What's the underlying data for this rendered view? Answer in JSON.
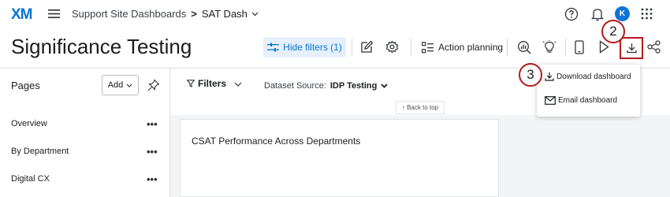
{
  "topbar": {
    "logo": "XM",
    "breadcrumb": {
      "parent": "Support Site Dashboards",
      "separator": ">",
      "current": "SAT Dash"
    },
    "avatar_initial": "K"
  },
  "header": {
    "title": "Significance Testing",
    "hide_filters_label": "Hide filters (1)",
    "action_planning_label": "Action planning"
  },
  "callouts": {
    "download": "2",
    "download_dashboard": "3"
  },
  "dropdown": {
    "items": [
      {
        "label": "Download dashboard",
        "icon": "download-icon"
      },
      {
        "label": "Email dashboard",
        "icon": "envelope-icon"
      }
    ]
  },
  "sidebar": {
    "pages_label": "Pages",
    "add_label": "Add",
    "items": [
      {
        "label": "Overview"
      },
      {
        "label": "By Department"
      },
      {
        "label": "Digital CX"
      }
    ],
    "more": "•••"
  },
  "filters": {
    "label": "Filters",
    "dataset_prefix": "Dataset Source:",
    "dataset_value": "IDP Testing"
  },
  "back_to_top": "↑ Back to top",
  "widget": {
    "title": "CSAT Performance Across Departments"
  },
  "colors": {
    "accent": "#0b73d4",
    "callout": "#b21b1b"
  }
}
